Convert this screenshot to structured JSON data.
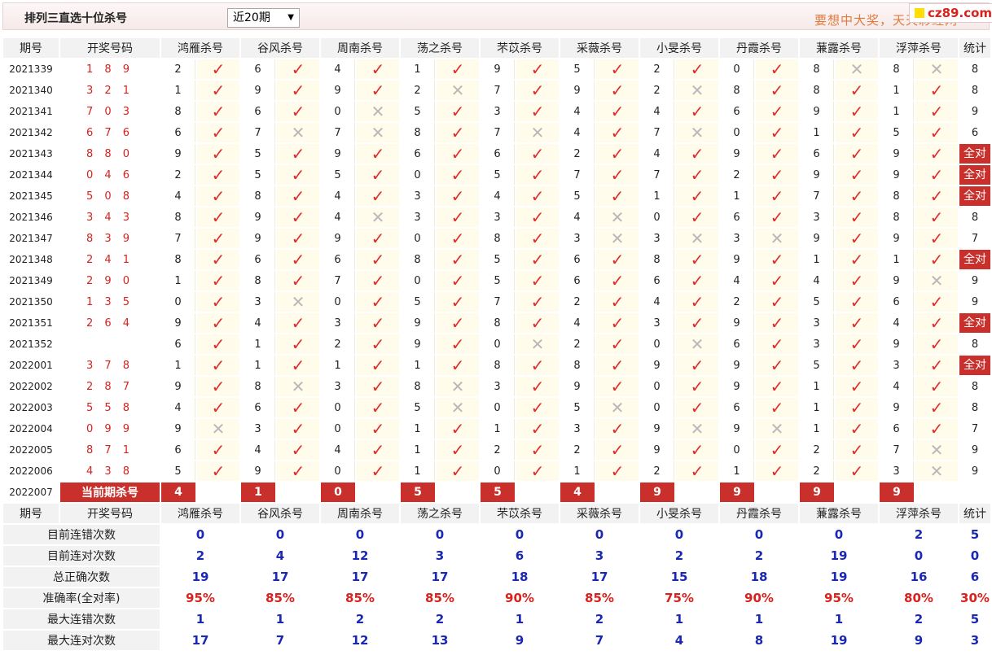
{
  "title": "排列三直选十位杀号",
  "select": "近20期",
  "slogan": "要想中大奖，天天彩经网",
  "logo": "cz89.com",
  "headers": [
    "期号",
    "开奖号码",
    "鸿雁杀号",
    "谷风杀号",
    "周南杀号",
    "荡之杀号",
    "芣苡杀号",
    "采薇杀号",
    "小旻杀号",
    "丹霞杀号",
    "蒹露杀号",
    "浮萍杀号",
    "统计"
  ],
  "rows": [
    {
      "period": "2021339",
      "open": "1 8 9",
      "kills": [
        2,
        6,
        4,
        1,
        9,
        5,
        2,
        0,
        8,
        8
      ],
      "ok": [
        1,
        1,
        1,
        1,
        1,
        1,
        1,
        1,
        0,
        0
      ],
      "stat": "8"
    },
    {
      "period": "2021340",
      "open": "3 2 1",
      "kills": [
        1,
        9,
        9,
        2,
        7,
        9,
        2,
        8,
        8,
        1
      ],
      "ok": [
        1,
        1,
        1,
        0,
        1,
        1,
        0,
        1,
        1,
        1
      ],
      "stat": "8"
    },
    {
      "period": "2021341",
      "open": "7 0 3",
      "kills": [
        8,
        6,
        0,
        5,
        3,
        4,
        4,
        6,
        9,
        1
      ],
      "ok": [
        1,
        1,
        0,
        1,
        1,
        1,
        1,
        1,
        1,
        1
      ],
      "stat": "9"
    },
    {
      "period": "2021342",
      "open": "6 7 6",
      "kills": [
        6,
        7,
        7,
        8,
        7,
        4,
        7,
        0,
        1,
        5
      ],
      "ok": [
        1,
        0,
        0,
        1,
        0,
        1,
        0,
        1,
        1,
        1
      ],
      "stat": "6"
    },
    {
      "period": "2021343",
      "open": "8 8 0",
      "kills": [
        9,
        5,
        9,
        6,
        6,
        2,
        4,
        9,
        6,
        9
      ],
      "ok": [
        1,
        1,
        1,
        1,
        1,
        1,
        1,
        1,
        1,
        1
      ],
      "stat": "全对"
    },
    {
      "period": "2021344",
      "open": "0 4 6",
      "kills": [
        2,
        5,
        5,
        0,
        5,
        7,
        7,
        2,
        9,
        9
      ],
      "ok": [
        1,
        1,
        1,
        1,
        1,
        1,
        1,
        1,
        1,
        1
      ],
      "stat": "全对"
    },
    {
      "period": "2021345",
      "open": "5 0 8",
      "kills": [
        4,
        8,
        4,
        3,
        4,
        5,
        1,
        1,
        7,
        8
      ],
      "ok": [
        1,
        1,
        1,
        1,
        1,
        1,
        1,
        1,
        1,
        1
      ],
      "stat": "全对"
    },
    {
      "period": "2021346",
      "open": "3 4 3",
      "kills": [
        8,
        9,
        4,
        3,
        3,
        4,
        0,
        6,
        3,
        8
      ],
      "ok": [
        1,
        1,
        0,
        1,
        1,
        0,
        1,
        1,
        1,
        1
      ],
      "stat": "8"
    },
    {
      "period": "2021347",
      "open": "8 3 9",
      "kills": [
        7,
        9,
        9,
        0,
        8,
        3,
        3,
        3,
        9,
        9
      ],
      "ok": [
        1,
        1,
        1,
        1,
        1,
        0,
        0,
        0,
        1,
        1
      ],
      "stat": "7"
    },
    {
      "period": "2021348",
      "open": "2 4 1",
      "kills": [
        8,
        6,
        6,
        8,
        5,
        6,
        8,
        9,
        1,
        1
      ],
      "ok": [
        1,
        1,
        1,
        1,
        1,
        1,
        1,
        1,
        1,
        1
      ],
      "stat": "全对"
    },
    {
      "period": "2021349",
      "open": "2 9 0",
      "kills": [
        1,
        8,
        7,
        0,
        5,
        6,
        6,
        4,
        4,
        9
      ],
      "ok": [
        1,
        1,
        1,
        1,
        1,
        1,
        1,
        1,
        1,
        0
      ],
      "stat": "9"
    },
    {
      "period": "2021350",
      "open": "1 3 5",
      "kills": [
        0,
        3,
        0,
        5,
        7,
        2,
        4,
        2,
        5,
        6
      ],
      "ok": [
        1,
        0,
        1,
        1,
        1,
        1,
        1,
        1,
        1,
        1
      ],
      "stat": "9"
    },
    {
      "period": "2021351",
      "open": "2 6 4",
      "kills": [
        9,
        4,
        3,
        9,
        8,
        4,
        3,
        9,
        3,
        4
      ],
      "ok": [
        1,
        1,
        1,
        1,
        1,
        1,
        1,
        1,
        1,
        1
      ],
      "stat": "全对"
    },
    {
      "period": "2021352",
      "open": "",
      "kills": [
        6,
        1,
        2,
        9,
        0,
        2,
        0,
        6,
        3,
        9
      ],
      "ok": [
        1,
        1,
        1,
        1,
        0,
        1,
        0,
        1,
        1,
        1
      ],
      "stat": "8"
    },
    {
      "period": "2022001",
      "open": "3 7 8",
      "kills": [
        1,
        1,
        1,
        1,
        8,
        8,
        9,
        9,
        5,
        3
      ],
      "ok": [
        1,
        1,
        1,
        1,
        1,
        1,
        1,
        1,
        1,
        1
      ],
      "stat": "全对"
    },
    {
      "period": "2022002",
      "open": "2 8 7",
      "kills": [
        9,
        8,
        3,
        8,
        3,
        9,
        0,
        9,
        1,
        4
      ],
      "ok": [
        1,
        0,
        1,
        0,
        1,
        1,
        1,
        1,
        1,
        1
      ],
      "stat": "8"
    },
    {
      "period": "2022003",
      "open": "5 5 8",
      "kills": [
        4,
        6,
        0,
        5,
        0,
        5,
        0,
        6,
        1,
        9
      ],
      "ok": [
        1,
        1,
        1,
        0,
        1,
        0,
        1,
        1,
        1,
        1
      ],
      "stat": "8"
    },
    {
      "period": "2022004",
      "open": "0 9 9",
      "kills": [
        9,
        3,
        0,
        1,
        1,
        3,
        9,
        9,
        1,
        6
      ],
      "ok": [
        0,
        1,
        1,
        1,
        1,
        1,
        0,
        0,
        1,
        1
      ],
      "stat": "7"
    },
    {
      "period": "2022005",
      "open": "8 7 1",
      "kills": [
        6,
        4,
        4,
        1,
        2,
        2,
        9,
        0,
        2,
        7
      ],
      "ok": [
        1,
        1,
        1,
        1,
        1,
        1,
        1,
        1,
        1,
        0
      ],
      "stat": "9"
    },
    {
      "period": "2022006",
      "open": "4 3 8",
      "kills": [
        5,
        9,
        0,
        1,
        0,
        1,
        2,
        1,
        2,
        3
      ],
      "ok": [
        1,
        1,
        1,
        1,
        1,
        1,
        1,
        1,
        1,
        0
      ],
      "stat": "9"
    }
  ],
  "current": {
    "period": "2022007",
    "label": "当前期杀号",
    "kills": [
      "4",
      "1",
      "0",
      "5",
      "5",
      "4",
      "9",
      "9",
      "9",
      "9"
    ]
  },
  "summary": [
    {
      "label": "目前连错次数",
      "values": [
        "0",
        "0",
        "0",
        "0",
        "0",
        "0",
        "0",
        "0",
        "0",
        "2",
        "5"
      ],
      "style": "blue"
    },
    {
      "label": "目前连对次数",
      "values": [
        "2",
        "4",
        "12",
        "3",
        "6",
        "3",
        "2",
        "2",
        "19",
        "0",
        "0"
      ],
      "style": "blue"
    },
    {
      "label": "总正确次数",
      "values": [
        "19",
        "17",
        "17",
        "17",
        "18",
        "17",
        "15",
        "18",
        "19",
        "16",
        "6"
      ],
      "style": "blue"
    },
    {
      "label": "准确率(全对率)",
      "values": [
        "95%",
        "85%",
        "85%",
        "85%",
        "90%",
        "85%",
        "75%",
        "90%",
        "95%",
        "80%",
        "30%"
      ],
      "style": "red"
    },
    {
      "label": "最大连错次数",
      "values": [
        "1",
        "1",
        "2",
        "2",
        "1",
        "2",
        "1",
        "1",
        "1",
        "2",
        "5"
      ],
      "style": "blue"
    },
    {
      "label": "最大连对次数",
      "values": [
        "17",
        "7",
        "12",
        "13",
        "9",
        "7",
        "4",
        "8",
        "19",
        "9",
        "3"
      ],
      "style": "blue"
    }
  ],
  "icons": {
    "correct": "check-icon",
    "wrong": "cross-icon"
  },
  "colors": {
    "red": "#d9211d",
    "blue": "#1a28b4",
    "highlight": "#c9302c"
  }
}
